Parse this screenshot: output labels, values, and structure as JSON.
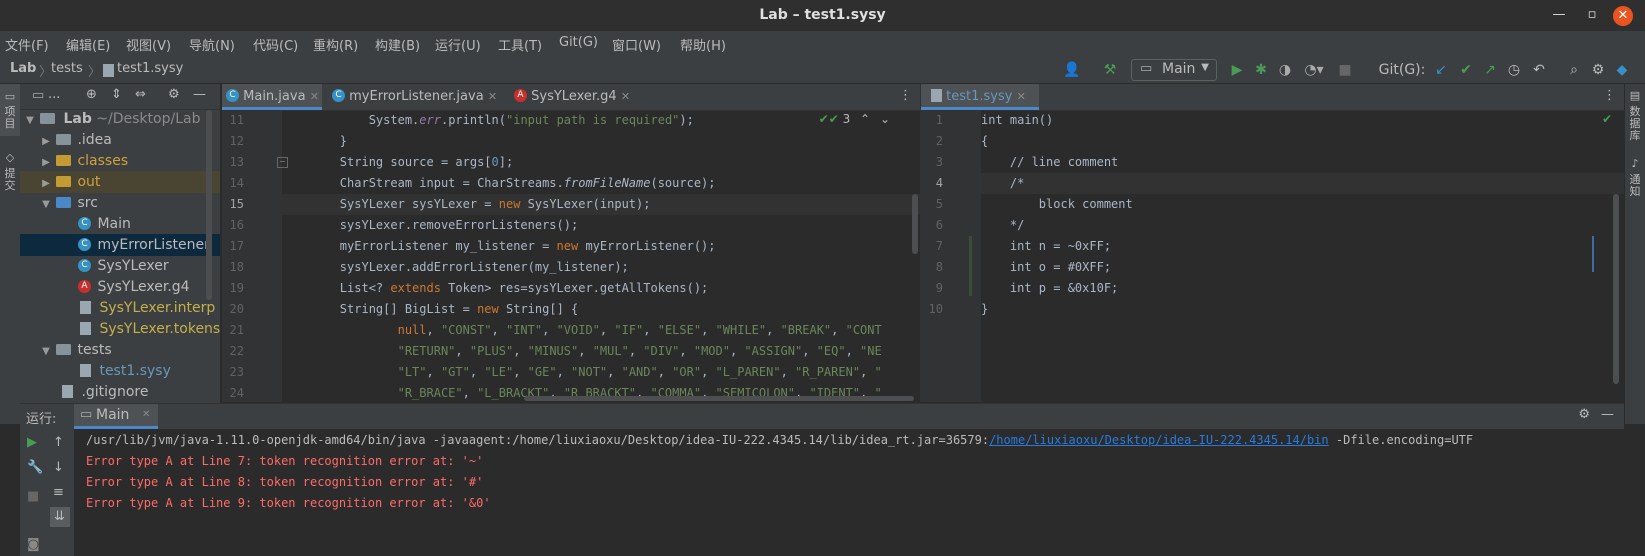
{
  "window": {
    "title": "Lab – test1.sysy"
  },
  "menu": [
    "文件(F)",
    "编辑(E)",
    "视图(V)",
    "导航(N)",
    "代码(C)",
    "重构(R)",
    "构建(B)",
    "运行(U)",
    "工具(T)",
    "Git(G)",
    "窗口(W)",
    "帮助(H)"
  ],
  "breadcrumb": [
    "Lab",
    "tests",
    "test1.sysy"
  ],
  "toolbar": {
    "run_config": "Main",
    "git_label": "Git(G):"
  },
  "left_strip": {
    "project": "项目",
    "commit": "提交"
  },
  "right_strip": {
    "database": "数据库",
    "notifications": "通知"
  },
  "project": {
    "header": "...",
    "root_name": "Lab",
    "root_path": "~/Desktop/Lab",
    "items": [
      {
        "label": "Lab"
      },
      {
        "label": ".idea"
      },
      {
        "label": "classes"
      },
      {
        "label": "out"
      },
      {
        "label": "src"
      },
      {
        "label": "Main"
      },
      {
        "label": "myErrorListener"
      },
      {
        "label": "SysYLexer"
      },
      {
        "label": "SysYLexer.g4"
      },
      {
        "label": "SysYLexer.interp"
      },
      {
        "label": "SysYLexer.tokens"
      },
      {
        "label": "tests"
      },
      {
        "label": "test1.sysy"
      },
      {
        "label": ".gitignore"
      }
    ]
  },
  "editor_left": {
    "tabs": [
      "Main.java",
      "myErrorListener.java",
      "SysYLexer.g4"
    ],
    "inspection_count": "3",
    "line_numbers": [
      "11",
      "12",
      "13",
      "14",
      "15",
      "16",
      "17",
      "18",
      "19",
      "20",
      "21",
      "22",
      "23",
      "24"
    ]
  },
  "editor_right": {
    "tabs": [
      "test1.sysy"
    ],
    "line_numbers": [
      "1",
      "2",
      "3",
      "4",
      "5",
      "6",
      "7",
      "8",
      "9",
      "10"
    ],
    "lines": [
      "int main()",
      "{",
      "    // line comment",
      "    /*",
      "        block comment",
      "    */",
      "    int n = ~0xFF;",
      "    int o = #0XFF;",
      "    int p = &0x10F;",
      "}"
    ]
  },
  "run": {
    "label": "运行:",
    "tab": "Main",
    "cmd_prefix": "/usr/lib/jvm/java-1.11.0-openjdk-amd64/bin/java -javaagent:/home/liuxiaoxu/Desktop/idea-IU-222.4345.14/lib/idea_rt.jar=36579:",
    "cmd_link": "/home/liuxiaoxu/Desktop/idea-IU-222.4345.14/bin",
    "cmd_suffix": " -Dfile.encoding=UTF",
    "errors": [
      "Error type A at Line 7: token recognition error at: '~'",
      "Error type A at Line 8: token recognition error at: '#'",
      "Error type A at Line 9: token recognition error at: '&0'"
    ]
  }
}
